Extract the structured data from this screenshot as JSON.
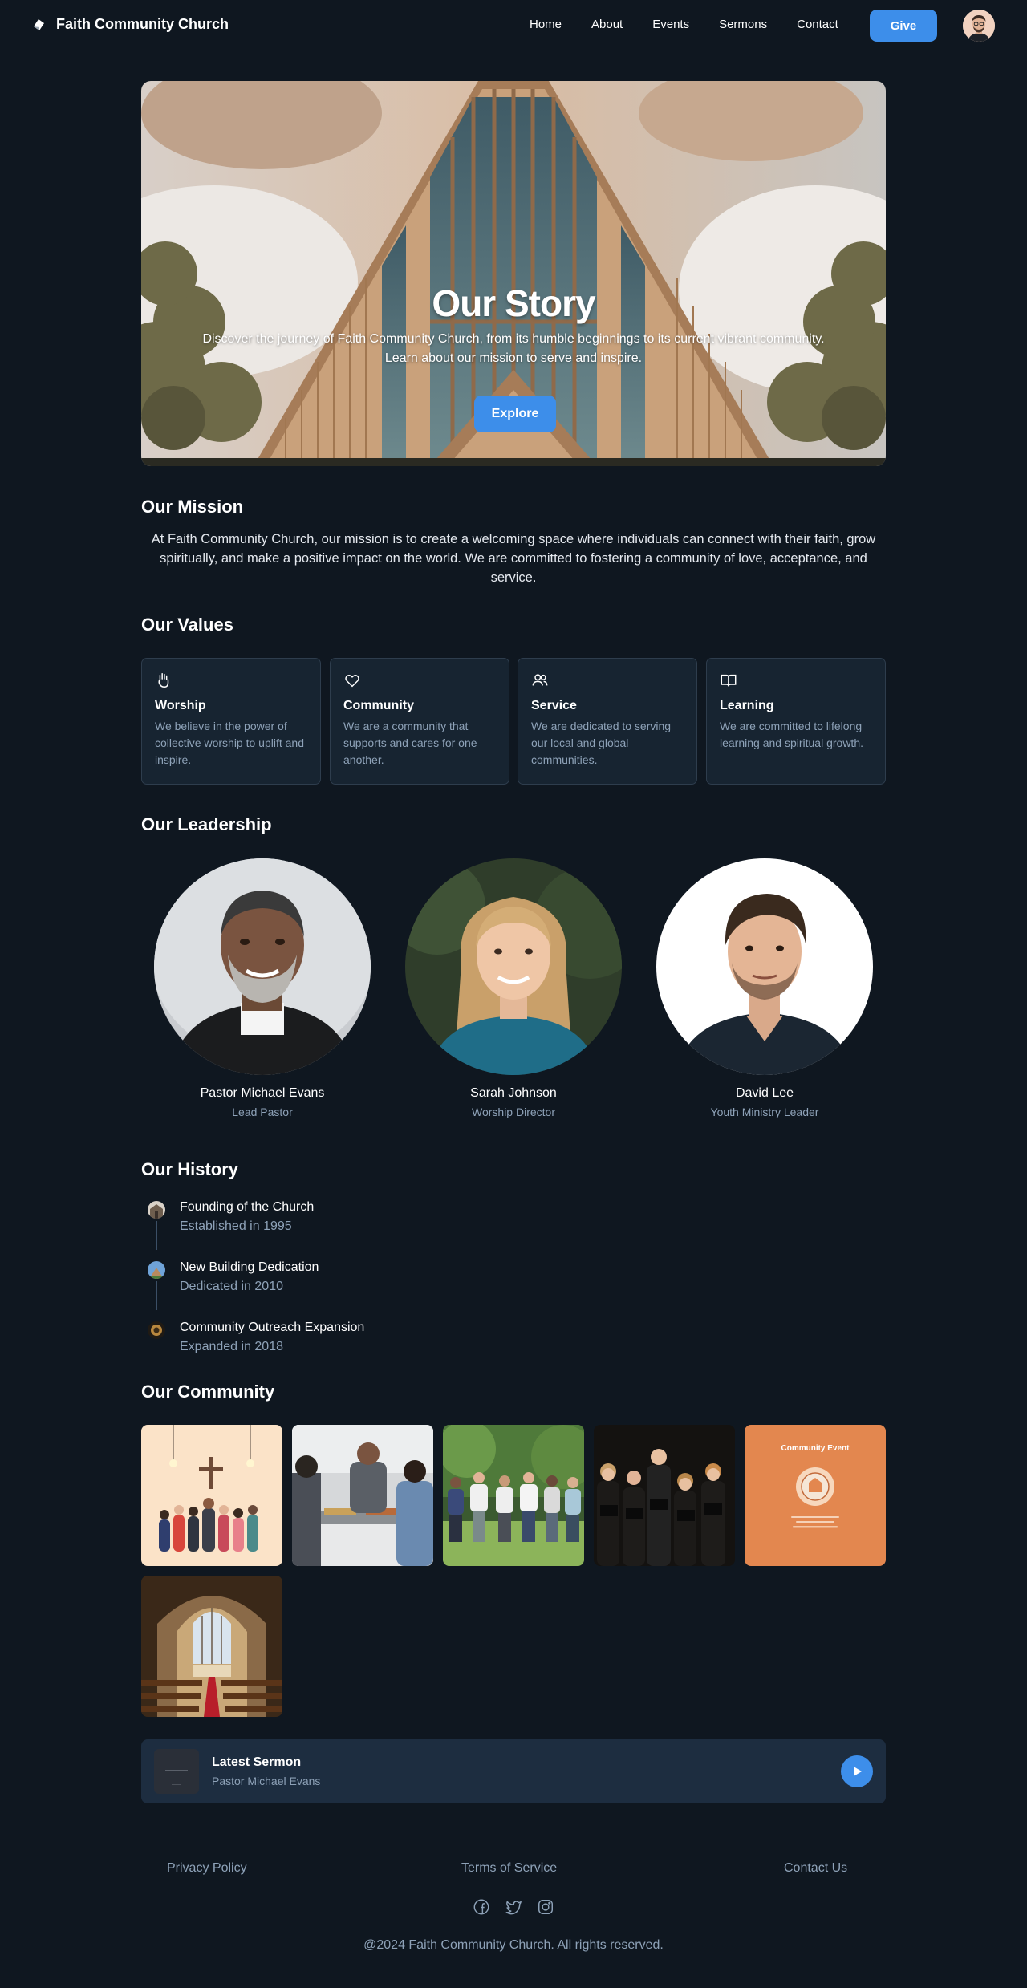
{
  "header": {
    "brand_name": "Faith Community Church",
    "nav": [
      "Home",
      "About",
      "Events",
      "Sermons",
      "Contact"
    ],
    "give_label": "Give"
  },
  "hero": {
    "title": "Our Story",
    "subtitle_line1": "Discover the journey of Faith Community Church, from its humble beginnings to its current vibrant community.",
    "subtitle_line2": "Learn about our mission to serve and inspire.",
    "button_label": "Explore"
  },
  "mission": {
    "heading": "Our Mission",
    "text": "At Faith Community Church, our mission is to create a welcoming space where individuals can connect with their faith, grow spiritually, and make a positive impact on the world. We are committed to fostering a community of love, acceptance, and service."
  },
  "values": {
    "heading": "Our Values",
    "items": [
      {
        "title": "Worship",
        "desc": "We believe in the power of collective worship to uplift and inspire.",
        "icon": "hands-icon"
      },
      {
        "title": "Community",
        "desc": "We are a community that supports and cares for one another.",
        "icon": "heart-icon"
      },
      {
        "title": "Service",
        "desc": "We are dedicated to serving our local and global communities.",
        "icon": "users-icon"
      },
      {
        "title": "Learning",
        "desc": "We are committed to lifelong learning and spiritual growth.",
        "icon": "book-icon"
      }
    ]
  },
  "leadership": {
    "heading": "Our Leadership",
    "people": [
      {
        "name": "Pastor Michael Evans",
        "role": "Lead Pastor"
      },
      {
        "name": "Sarah Johnson",
        "role": "Worship Director"
      },
      {
        "name": "David Lee",
        "role": "Youth Ministry Leader"
      }
    ]
  },
  "history": {
    "heading": "Our History",
    "items": [
      {
        "title": "Founding of the Church",
        "date": "Established in 1995"
      },
      {
        "title": "New Building Dedication",
        "date": "Dedicated in 2010"
      },
      {
        "title": "Community Outreach Expansion",
        "date": "Expanded in 2018"
      }
    ]
  },
  "community": {
    "heading": "Our Community",
    "event_card_title": "Community Event"
  },
  "sermon": {
    "title": "Latest Sermon",
    "speaker": "Pastor Michael Evans"
  },
  "footer": {
    "links": [
      "Privacy Policy",
      "Terms of Service",
      "Contact Us"
    ],
    "copyright": "@2024 Faith Community Church. All rights reserved."
  },
  "colors": {
    "background": "#0f1720",
    "accent": "#3d8eea",
    "card": "#172431",
    "muted_text": "#8ea2b8"
  }
}
